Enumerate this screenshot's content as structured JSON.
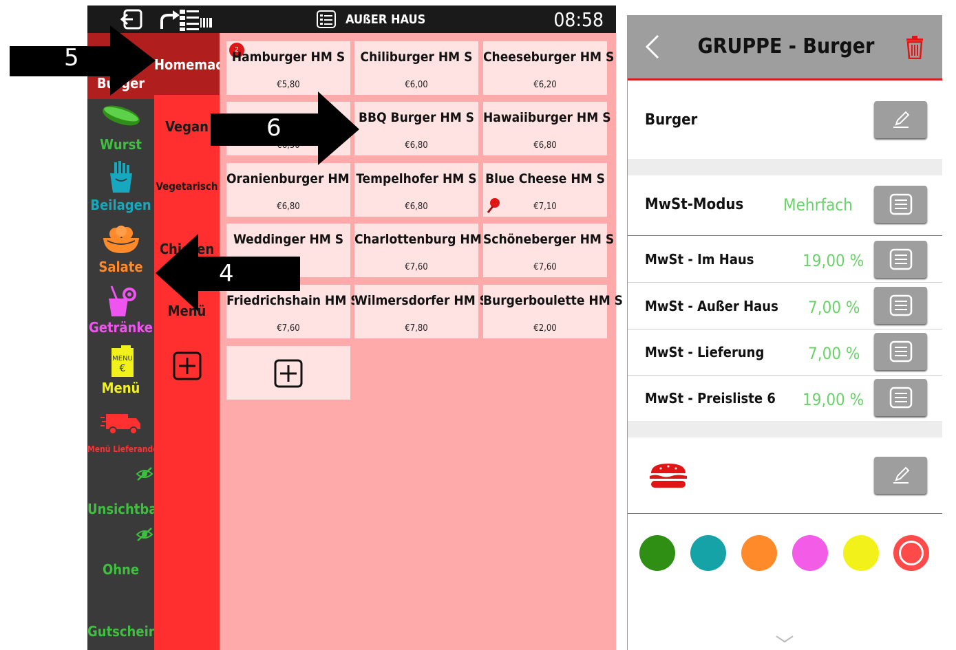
{
  "top_bar": {
    "logout_icon": "logout-icon",
    "routing_icon": "routing-icon",
    "mode_icon": "takeaway-list-icon",
    "mode_text": "AUßER HAUS",
    "time": "08:58"
  },
  "categories": [
    {
      "label": "Burger",
      "icon": "burger-icon",
      "color": "#ffffff"
    },
    {
      "label": "Wurst",
      "icon": "hotdog-icon",
      "color": "#3fbf3f"
    },
    {
      "label": "Beilagen",
      "icon": "fries-icon",
      "color": "#17a8c0"
    },
    {
      "label": "Salate",
      "icon": "salad-bowl-icon",
      "color": "#ff8a2a"
    },
    {
      "label": "Getränke",
      "icon": "cocktail-icon",
      "color": "#ee55ee"
    },
    {
      "label": "Menü",
      "icon": "menu-card-icon",
      "color": "#f2f21a"
    },
    {
      "label": "Menü Lieferando",
      "icon": "delivery-truck-icon",
      "color": "#ff3030"
    },
    {
      "label": "Unsichtbar",
      "icon": "hidden-eye-icon",
      "color": "#3fbf3f"
    },
    {
      "label": "Ohne",
      "icon": "hidden-eye-icon",
      "color": "#3fbf3f"
    },
    {
      "label": "Gutschein",
      "icon": "",
      "color": "#3fbf3f"
    }
  ],
  "subcategories": [
    "Homemade",
    "Vegan",
    "Vegetarisch",
    "Chicken",
    "Menü"
  ],
  "items": [
    {
      "name": "Hamburger HM S",
      "price": "€5,80",
      "badge": "2"
    },
    {
      "name": "Chiliburger HM S",
      "price": "€6,00"
    },
    {
      "name": "Cheeseburger HM S",
      "price": "€6,20"
    },
    {
      "name": "",
      "price": "€6,50"
    },
    {
      "name": "BBQ Burger HM S",
      "price": "€6,80"
    },
    {
      "name": "Hawaiiburger HM S",
      "price": "€6,80"
    },
    {
      "name": "Oranienburger HM S",
      "price": "€6,80"
    },
    {
      "name": "Tempelhofer HM S",
      "price": "€6,80"
    },
    {
      "name": "Blue Cheese HM S",
      "price": "€7,10",
      "pinned": true
    },
    {
      "name": "Weddinger HM S",
      "price": ""
    },
    {
      "name": "Charlottenburg HM S",
      "price": "€7,60"
    },
    {
      "name": "Schöneberger HM S",
      "price": "€7,60"
    },
    {
      "name": "Friedrichshain HM S",
      "price": "€7,60"
    },
    {
      "name": "Wilmersdorfer HM S",
      "price": "€7,80"
    },
    {
      "name": "Burgerboulette HM S",
      "price": "€2,00"
    }
  ],
  "annotations": [
    "5",
    "6",
    "4"
  ],
  "panel": {
    "title": "GRUPPE - Burger",
    "group_name": "Burger",
    "mwst_modus_label": "MwSt-Modus",
    "mwst_modus_value": "Mehrfach",
    "vat_rows": [
      {
        "label": "MwSt - Im Haus",
        "value": "19,00 %"
      },
      {
        "label": "MwSt - Außer Haus",
        "value": "7,00 %"
      },
      {
        "label": "MwSt - Lieferung",
        "value": "7,00 %"
      },
      {
        "label": "MwSt - Preisliste 6",
        "value": "19,00 %"
      }
    ],
    "group_icon": "burger-icon",
    "colors": [
      "#2e8f14",
      "#16a3a8",
      "#ff8a2a",
      "#f25ce6",
      "#f2f21a",
      "#ff4a4a"
    ]
  },
  "colors": {
    "accent_red": "#ff2f2f",
    "dark_red": "#b11e1e",
    "grid_bg": "#ffaaaa",
    "tile_bg": "#ffe3e3",
    "value_green": "#6bd26b"
  }
}
